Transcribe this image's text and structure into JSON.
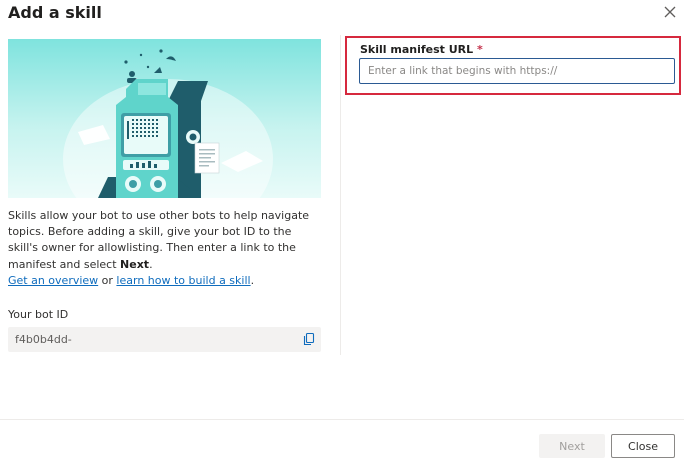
{
  "dialog": {
    "title": "Add a skill"
  },
  "left": {
    "description_part1": "Skills allow your bot to use other bots to help navigate topics. Before adding a skill, give your bot ID to the skill's owner for allowlisting. Then enter a link to the manifest and select ",
    "description_bold": "Next",
    "description_part2": ".",
    "link_overview": "Get an overview",
    "link_or": " or ",
    "link_build": "learn how to build a skill",
    "link_end": ".",
    "bot_id_label": "Your bot ID",
    "bot_id_value": "f4b0b4dd-"
  },
  "right": {
    "url_label": "Skill manifest URL",
    "url_required_mark": " *",
    "url_placeholder": "Enter a link that begins with https://",
    "url_value": ""
  },
  "footer": {
    "next_label": "Next",
    "close_label": "Close"
  },
  "colors": {
    "accent": "#0f6cbd",
    "highlight_border": "#d6293e",
    "illustration_teal": "#5fd4cb",
    "illustration_dark": "#1f5d6b"
  },
  "icons": [
    "close-icon",
    "copy-icon"
  ]
}
